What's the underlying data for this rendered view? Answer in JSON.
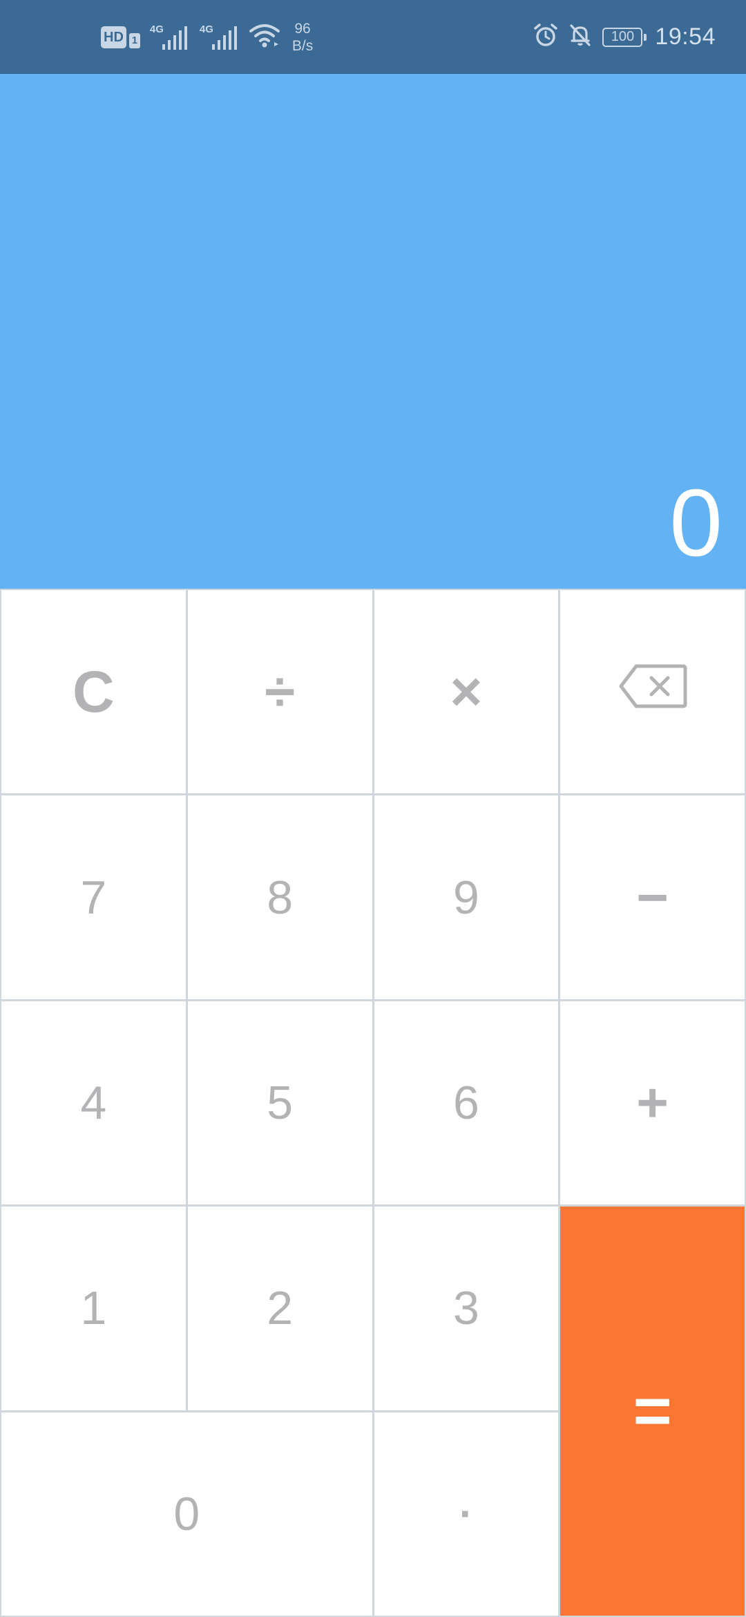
{
  "status_bar": {
    "hd": "HD",
    "sim": "1",
    "network_1": "4G",
    "network_2": "4G",
    "speed_value": "96",
    "speed_unit": "B/s",
    "battery": "100",
    "time": "19:54",
    "icons": [
      "signal-icon",
      "wifi-icon",
      "alarm-icon",
      "bell-muted-icon",
      "battery-icon"
    ],
    "color": "#3b6b94"
  },
  "display": {
    "value": "0",
    "background": "#63b2f4"
  },
  "keypad": {
    "clear": "C",
    "divide": "÷",
    "multiply": "×",
    "backspace_icon": "backspace-icon",
    "seven": "7",
    "eight": "8",
    "nine": "9",
    "minus": "−",
    "four": "4",
    "five": "5",
    "six": "6",
    "plus": "+",
    "one": "1",
    "two": "2",
    "three": "3",
    "equals": "=",
    "zero": "0",
    "dot": "·",
    "equals_color": "#fb7633"
  }
}
